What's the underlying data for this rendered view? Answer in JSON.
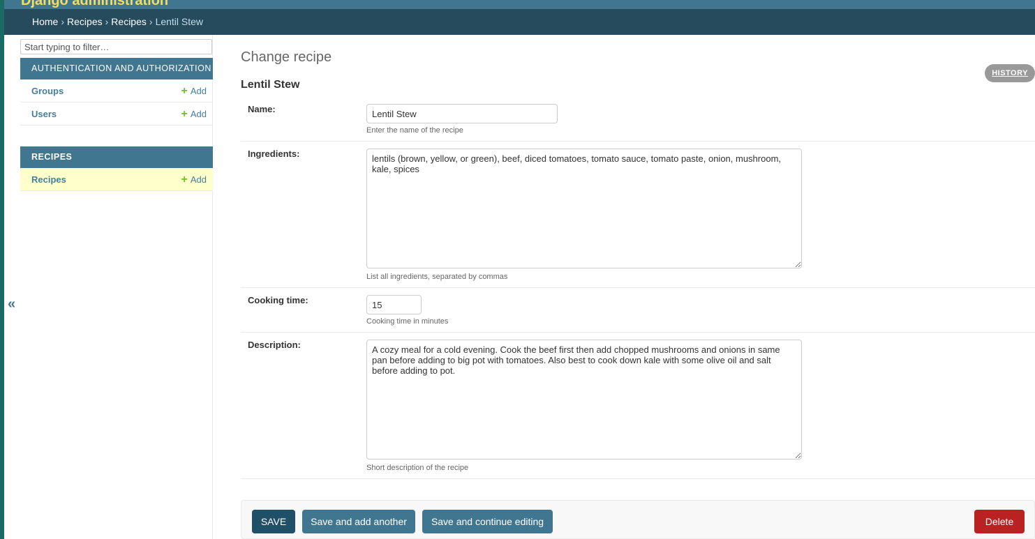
{
  "brand": "Django administration",
  "breadcrumb": {
    "home": "Home",
    "app": "Recipes",
    "model": "Recipes",
    "current": "Lentil Stew",
    "separator": "›"
  },
  "sidebar": {
    "collapse_icon": "«",
    "filter_placeholder": "Start typing to filter…",
    "modules": [
      {
        "caption": "AUTHENTICATION AND AUTHORIZATION",
        "rows": [
          {
            "name": "Groups",
            "add": "Add"
          },
          {
            "name": "Users",
            "add": "Add"
          }
        ]
      },
      {
        "caption": "RECIPES",
        "rows": [
          {
            "name": "Recipes",
            "add": "Add"
          }
        ]
      }
    ],
    "add_icon": "+"
  },
  "content": {
    "page_title": "Change recipe",
    "history_label": "HISTORY",
    "object_title": "Lentil Stew",
    "fields": {
      "name": {
        "label": "Name:",
        "value": "Lentil Stew",
        "help": "Enter the name of the recipe"
      },
      "ingredients": {
        "label": "Ingredients:",
        "value": "lentils (brown, yellow, or green), beef, diced tomatoes, tomato sauce, tomato paste, onion, mushroom, kale, spices",
        "help": "List all ingredients, separated by commas"
      },
      "cooking_time": {
        "label": "Cooking time:",
        "value": "15",
        "help": "Cooking time in minutes"
      },
      "description": {
        "label": "Description:",
        "value": "A cozy meal for a cold evening. Cook the beef first then add chopped mushrooms and onions in same pan before adding to big pot with tomatoes. Also best to cook down kale with some olive oil and salt before adding to pot.",
        "help": "Short description of the recipe"
      }
    },
    "buttons": {
      "save": "SAVE",
      "save_add": "Save and add another",
      "save_continue": "Save and continue editing",
      "delete": "Delete"
    }
  },
  "colors": {
    "header": "#417690",
    "breadcrumbs": "#264b5d",
    "brand": "#f5dd5d",
    "add_plus": "#70bf2b",
    "current_row": "#ffffcc",
    "delete": "#ba2121"
  }
}
